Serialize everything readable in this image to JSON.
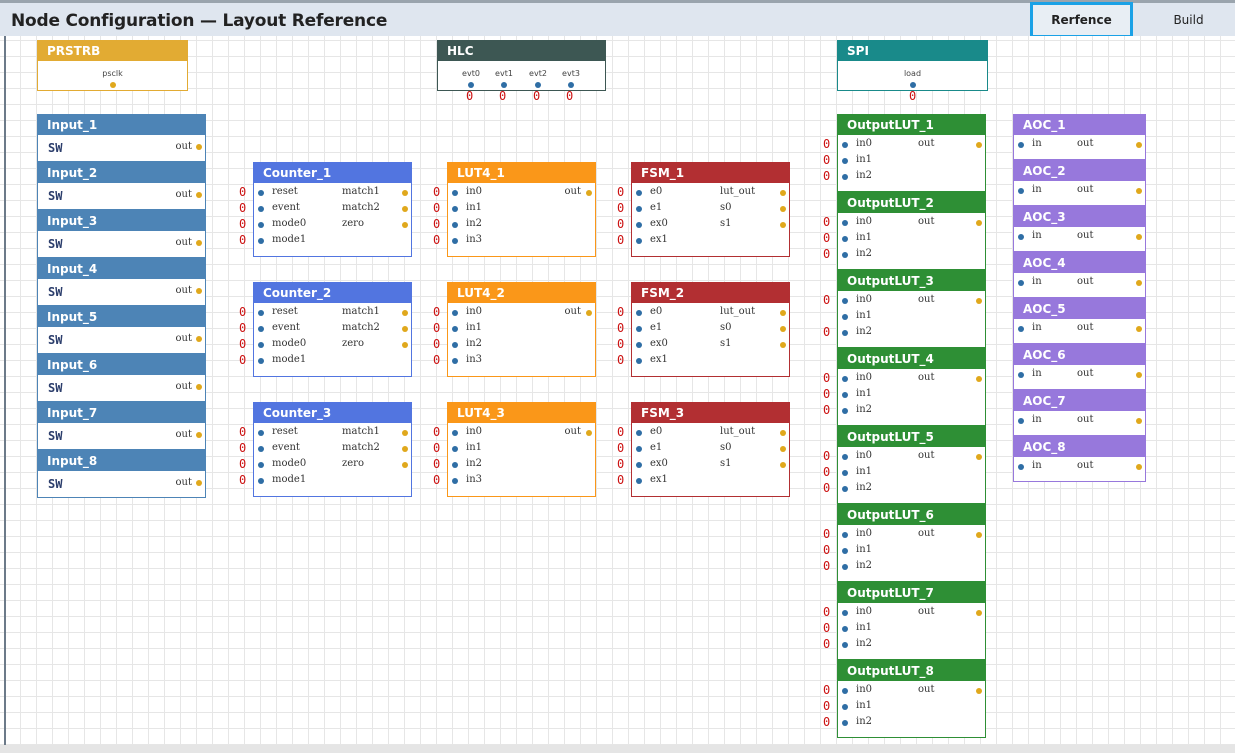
{
  "header": {
    "title": "Node Configuration — Layout Reference",
    "buttons": {
      "reference": "Rerfence",
      "build": "Build"
    }
  },
  "colors": {
    "input": "#4d84b6",
    "counter": "#5275e0",
    "lut4": "#fa9719",
    "fsm": "#b22f32",
    "outputlut": "#2e8f35",
    "aoc": "#9778dc",
    "prstrb": "#e2ab33",
    "hlc": "#3d5753",
    "spi": "#198a8a",
    "zero": "#cc1111"
  },
  "markers": {
    "zero": "0",
    "sw": "SW"
  },
  "nodes": {
    "prstrb": {
      "title": "PRSTRB",
      "ports": [
        "psclk"
      ]
    },
    "hlc": {
      "title": "HLC",
      "ports": [
        "evt0",
        "evt1",
        "evt2",
        "evt3"
      ]
    },
    "spi": {
      "title": "SPI",
      "ports": [
        "load"
      ]
    },
    "inputs": [
      {
        "title": "Input_1",
        "out": "out"
      },
      {
        "title": "Input_2",
        "out": "out"
      },
      {
        "title": "Input_3",
        "out": "out"
      },
      {
        "title": "Input_4",
        "out": "out"
      },
      {
        "title": "Input_5",
        "out": "out"
      },
      {
        "title": "Input_6",
        "out": "out"
      },
      {
        "title": "Input_7",
        "out": "out"
      },
      {
        "title": "Input_8",
        "out": "out"
      }
    ],
    "counters": [
      {
        "title": "Counter_1",
        "inputs": [
          "reset",
          "event",
          "mode0",
          "mode1"
        ],
        "outputs": [
          "match1",
          "match2",
          "zero"
        ]
      },
      {
        "title": "Counter_2",
        "inputs": [
          "reset",
          "event",
          "mode0",
          "mode1"
        ],
        "outputs": [
          "match1",
          "match2",
          "zero"
        ]
      },
      {
        "title": "Counter_3",
        "inputs": [
          "reset",
          "event",
          "mode0",
          "mode1"
        ],
        "outputs": [
          "match1",
          "match2",
          "zero"
        ]
      }
    ],
    "luts": [
      {
        "title": "LUT4_1",
        "inputs": [
          "in0",
          "in1",
          "in2",
          "in3"
        ],
        "outputs": [
          "out"
        ]
      },
      {
        "title": "LUT4_2",
        "inputs": [
          "in0",
          "in1",
          "in2",
          "in3"
        ],
        "outputs": [
          "out"
        ]
      },
      {
        "title": "LUT4_3",
        "inputs": [
          "in0",
          "in1",
          "in2",
          "in3"
        ],
        "outputs": [
          "out"
        ]
      }
    ],
    "fsms": [
      {
        "title": "FSM_1",
        "inputs": [
          "e0",
          "e1",
          "ex0",
          "ex1"
        ],
        "outputs": [
          "lut_out",
          "s0",
          "s1"
        ]
      },
      {
        "title": "FSM_2",
        "inputs": [
          "e0",
          "e1",
          "ex0",
          "ex1"
        ],
        "outputs": [
          "lut_out",
          "s0",
          "s1"
        ]
      },
      {
        "title": "FSM_3",
        "inputs": [
          "e0",
          "e1",
          "ex0",
          "ex1"
        ],
        "outputs": [
          "lut_out",
          "s0",
          "s1"
        ]
      }
    ],
    "outputluts": [
      {
        "title": "OutputLUT_1",
        "inputs": [
          "in0",
          "in1",
          "in2"
        ],
        "outputs": [
          "out"
        ]
      },
      {
        "title": "OutputLUT_2",
        "inputs": [
          "in0",
          "in1",
          "in2"
        ],
        "outputs": [
          "out"
        ]
      },
      {
        "title": "OutputLUT_3",
        "inputs": [
          "in0",
          "in1",
          "in2"
        ],
        "outputs": [
          "out"
        ]
      },
      {
        "title": "OutputLUT_4",
        "inputs": [
          "in0",
          "in1",
          "in2"
        ],
        "outputs": [
          "out"
        ]
      },
      {
        "title": "OutputLUT_5",
        "inputs": [
          "in0",
          "in1",
          "in2"
        ],
        "outputs": [
          "out"
        ]
      },
      {
        "title": "OutputLUT_6",
        "inputs": [
          "in0",
          "in1",
          "in2"
        ],
        "outputs": [
          "out"
        ]
      },
      {
        "title": "OutputLUT_7",
        "inputs": [
          "in0",
          "in1",
          "in2"
        ],
        "outputs": [
          "out"
        ]
      },
      {
        "title": "OutputLUT_8",
        "inputs": [
          "in0",
          "in1",
          "in2"
        ],
        "outputs": [
          "out"
        ]
      }
    ],
    "aocs": [
      {
        "title": "AOC_1",
        "inputs": [
          "in"
        ],
        "outputs": [
          "out"
        ]
      },
      {
        "title": "AOC_2",
        "inputs": [
          "in"
        ],
        "outputs": [
          "out"
        ]
      },
      {
        "title": "AOC_3",
        "inputs": [
          "in"
        ],
        "outputs": [
          "out"
        ]
      },
      {
        "title": "AOC_4",
        "inputs": [
          "in"
        ],
        "outputs": [
          "out"
        ]
      },
      {
        "title": "AOC_5",
        "inputs": [
          "in"
        ],
        "outputs": [
          "out"
        ]
      },
      {
        "title": "AOC_6",
        "inputs": [
          "in"
        ],
        "outputs": [
          "out"
        ]
      },
      {
        "title": "AOC_7",
        "inputs": [
          "in"
        ],
        "outputs": [
          "out"
        ]
      },
      {
        "title": "AOC_8",
        "inputs": [
          "in"
        ],
        "outputs": [
          "out"
        ]
      }
    ]
  }
}
